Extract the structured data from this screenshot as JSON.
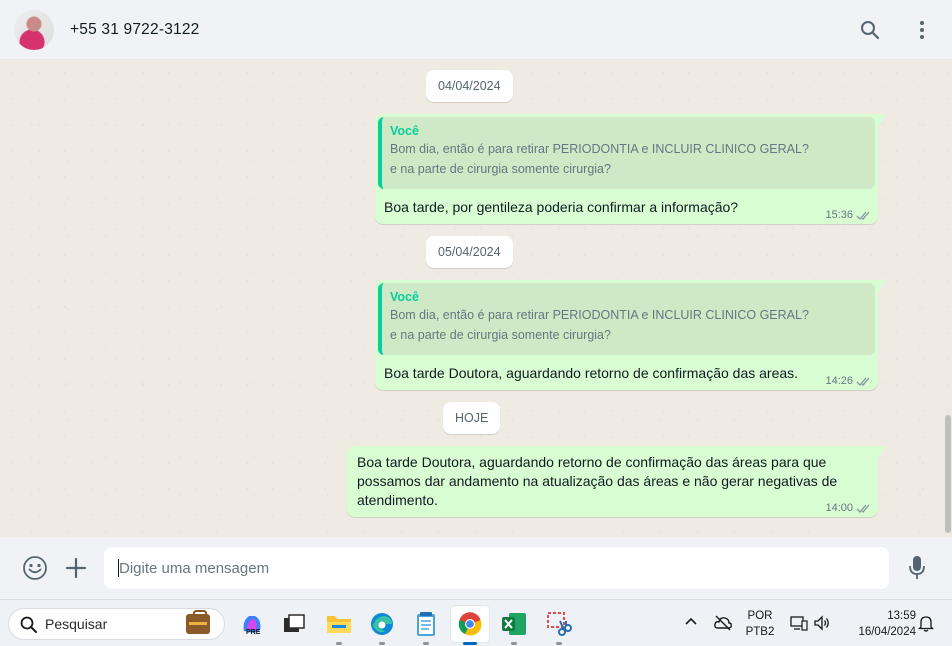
{
  "header": {
    "contact_name": "+55 31 9722-3122",
    "icons": [
      "search-icon",
      "menu-icon"
    ]
  },
  "chat": {
    "date_chips": [
      "04/04/2024",
      "05/04/2024",
      "HOJE"
    ],
    "messages": [
      {
        "quote_author": "Você",
        "quote_line1": "Bom dia, então é para retirar PERIODONTIA e INCLUIR CLINICO GERAL?",
        "quote_line2": "e na parte de cirurgia somente cirurgia?",
        "text": "Boa tarde, por gentileza poderia confirmar a informação?",
        "time": "15:36",
        "status": "read"
      },
      {
        "quote_author": "Você",
        "quote_line1": "Bom dia, então é para retirar PERIODONTIA e INCLUIR CLINICO GERAL?",
        "quote_line2": "e na parte de cirurgia somente cirurgia?",
        "text": "Boa tarde Doutora, aguardando retorno de confirmação das areas.",
        "time": "14:26",
        "status": "read"
      },
      {
        "line1": "Boa tarde Doutora, aguardando retorno de confirmação das áreas para que",
        "line2": "possamos dar andamento na atualização das áreas e não gerar negativas de",
        "line3": "atendimento.",
        "time": "14:00",
        "status": "read"
      }
    ]
  },
  "compose": {
    "placeholder": "Digite uma mensagem",
    "value": "",
    "icons": [
      "emoji-icon",
      "plus-icon",
      "microphone-icon"
    ]
  },
  "taskbar": {
    "search_label": "Pesquisar",
    "apps": [
      "copilot-icon",
      "task-view-icon",
      "file-explorer-icon",
      "edge-icon",
      "notepad-icon",
      "chrome-icon",
      "excel-icon",
      "snipping-tool-icon"
    ],
    "language_line1": "POR",
    "language_line2": "PTB2",
    "time": "13:59",
    "date": "16/04/2024"
  },
  "colors": {
    "bubble_out": "#d9fdd3",
    "quote_bar": "#06cf9c",
    "read_ticks": "#53bdeb",
    "header_bg": "#f0f2f5",
    "chat_bg": "#efeae2"
  }
}
